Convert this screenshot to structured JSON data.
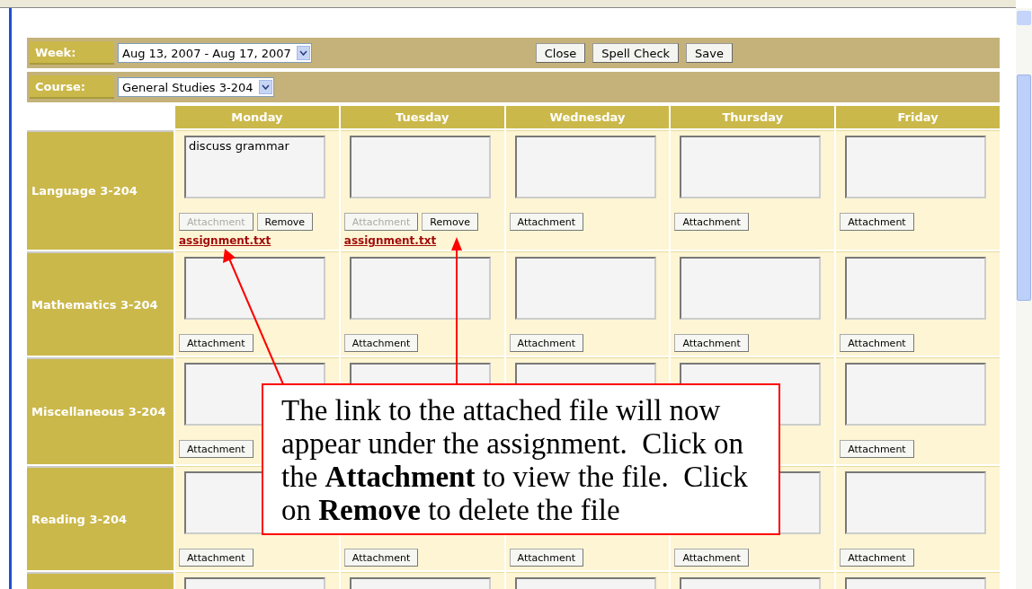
{
  "week": {
    "label": "Week:",
    "value": "Aug 13, 2007 - Aug 17, 2007"
  },
  "buttons": [
    "Close",
    "Spell Check",
    "Save"
  ],
  "course": {
    "label": "Course:",
    "value": "General Studies 3-204"
  },
  "days": [
    "Monday",
    "Tuesday",
    "Wednesday",
    "Thursday",
    "Friday"
  ],
  "rows": [
    {
      "label": "Language 3-204",
      "cells": [
        {
          "text": "discuss grammar",
          "attachment": {
            "label": "Attachment",
            "disabled": true
          },
          "remove": "Remove",
          "file": "assignment.txt"
        },
        {
          "attachment": {
            "label": "Attachment",
            "disabled": true
          },
          "remove": "Remove",
          "file": "assignment.txt"
        },
        {
          "attachment": {
            "label": "Attachment",
            "disabled": false
          }
        },
        {
          "attachment": {
            "label": "Attachment",
            "disabled": false
          }
        },
        {
          "attachment": {
            "label": "Attachment",
            "disabled": false
          }
        }
      ]
    },
    {
      "label": "Mathematics 3-204",
      "cells": [
        {
          "attachment": {
            "label": "Attachment",
            "disabled": false
          }
        },
        {
          "attachment": {
            "label": "Attachment",
            "disabled": false
          }
        },
        {
          "attachment": {
            "label": "Attachment",
            "disabled": false
          }
        },
        {
          "attachment": {
            "label": "Attachment",
            "disabled": false
          }
        },
        {
          "attachment": {
            "label": "Attachment",
            "disabled": false
          }
        }
      ]
    },
    {
      "label": "Miscellaneous 3-204",
      "cells": [
        {
          "attachment": {
            "label": "Attachment",
            "disabled": false
          }
        },
        {},
        {},
        {},
        {
          "attachment": {
            "label": "Attachment",
            "disabled": false
          }
        }
      ]
    },
    {
      "label": "Reading 3-204",
      "cells": [
        {
          "attachment": {
            "label": "Attachment",
            "disabled": false
          }
        },
        {
          "attachment": {
            "label": "Attachment",
            "disabled": false
          }
        },
        {
          "attachment": {
            "label": "Attachment",
            "disabled": false
          }
        },
        {
          "attachment": {
            "label": "Attachment",
            "disabled": false
          }
        },
        {
          "attachment": {
            "label": "Attachment",
            "disabled": false
          }
        }
      ]
    },
    {
      "cells": [
        {},
        {},
        {},
        {},
        {}
      ]
    }
  ],
  "callout": {
    "text": "The link to the attached file will now appear under the assignment.  Click on the **Attachment** to view the file.  Click on **Remove** to delete the file"
  }
}
